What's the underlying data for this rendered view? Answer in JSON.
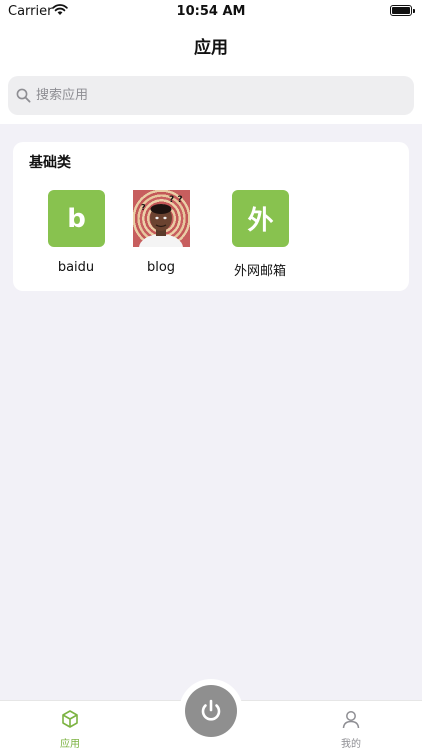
{
  "status_bar": {
    "carrier": "Carrier",
    "time": "10:54 AM"
  },
  "nav": {
    "title": "应用"
  },
  "search": {
    "placeholder": "搜索应用",
    "value": ""
  },
  "category": {
    "title": "基础类",
    "apps": [
      {
        "label": "baidu",
        "icon_text": "b",
        "icon": "letter-b-icon"
      },
      {
        "label": "blog",
        "icon_text": "",
        "icon": "avatar-image-icon"
      },
      {
        "label": "外网邮箱",
        "icon_text": "外",
        "icon": "letter-wai-icon"
      }
    ]
  },
  "tab_bar": {
    "tabs": [
      {
        "label": "应用",
        "icon": "cube-icon",
        "active": true
      },
      {
        "label": "我的",
        "icon": "person-icon",
        "active": false
      }
    ],
    "center_button": "power-icon"
  },
  "colors": {
    "accent": "#88c24f",
    "tab_active": "#7cb342",
    "background": "#f2f1f7",
    "power_button": "#8f8f8f"
  }
}
